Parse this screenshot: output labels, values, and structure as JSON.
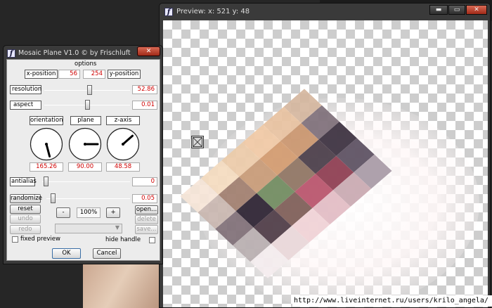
{
  "preview": {
    "title": "Preview:",
    "coord_text": "x: 521 y: 48",
    "buttons": {
      "minimize": "▬",
      "maximize": "▭",
      "close": "✕"
    }
  },
  "watermark": "http://www.liveinternet.ru/users/krilo_angela/",
  "dialog": {
    "title": "Mosaic Plane V1.0 © by Frischluft in...",
    "close_glyph": "✕",
    "options_heading": "options",
    "x_position_label": "x-position",
    "x_value": "56",
    "y_value": "254",
    "y_position_label": "y-position",
    "resolution": {
      "label": "resolution",
      "value": "52.86",
      "level": 0.53
    },
    "aspect": {
      "label": "aspect",
      "value": "0.01",
      "level": 0.5
    },
    "dials": [
      {
        "label": "orientation",
        "value": "165.26",
        "angle": 165.26
      },
      {
        "label": "plane",
        "value": "90.00",
        "angle": 90
      },
      {
        "label": "z-axis",
        "value": "48.58",
        "angle": 48.58
      }
    ],
    "antialias": {
      "label": "antialias",
      "value": "0",
      "level": 0.0
    },
    "randomize": {
      "label": "randomize",
      "value": "0.05",
      "level": 0.05
    },
    "buttons": {
      "reset": "reset",
      "undo": "undo",
      "redo": "redo",
      "zoom_out": "-",
      "zoom_in": "+",
      "open": "open...",
      "delete": "delete",
      "save": "save..."
    },
    "zoom": "100%",
    "fixed_preview_label": "fixed preview",
    "hide_handle_label": "hide handle",
    "ok_label": "OK",
    "cancel_label": "Cancel"
  },
  "colors": {
    "value_red": "#d00000",
    "title_bar": "#3a3a3a"
  }
}
